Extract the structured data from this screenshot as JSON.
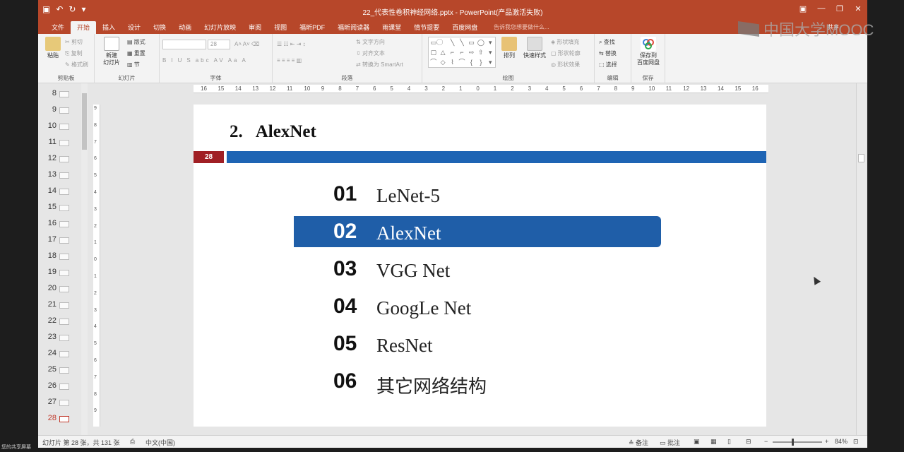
{
  "window": {
    "title": "22_代表性卷积神经网络.pptx - PowerPoint(产品激活失败)",
    "qat_icons": [
      "save-icon",
      "undo-icon",
      "redo-icon",
      "customize-icon"
    ],
    "controls": [
      "▣",
      "—",
      "❐",
      "✕"
    ]
  },
  "tabs": [
    "文件",
    "开始",
    "插入",
    "设计",
    "切换",
    "动画",
    "幻灯片放映",
    "审阅",
    "视图",
    "福昕PDF",
    "福昕阅读器",
    "雨课堂",
    "情节提要",
    "百度网盘"
  ],
  "active_tab": "开始",
  "tell_me": "告诉我您想要做什么...",
  "share": "共享",
  "ribbon": {
    "clipboard": {
      "label": "剪贴板",
      "paste": "粘贴",
      "cut": "剪切",
      "copy": "复制",
      "format_painter": "格式刷"
    },
    "slides": {
      "label": "幻灯片",
      "new_slide": "新建\n幻灯片",
      "layout": "版式",
      "reset": "重置",
      "section": "节"
    },
    "font": {
      "label": "字体",
      "font_size": "28",
      "styles": [
        "B",
        "I",
        "U",
        "S",
        "abc",
        "AV",
        "Aa",
        "A"
      ]
    },
    "paragraph": {
      "label": "段落",
      "text_direction": "文字方向",
      "align_text": "对齐文本",
      "smartart": "转换为 SmartArt"
    },
    "drawing": {
      "label": "绘图",
      "arrange": "排列",
      "quick_styles": "快速样式",
      "shape_fill": "形状填充",
      "shape_outline": "形状轮廓",
      "shape_effects": "形状效果"
    },
    "editing": {
      "label": "编辑",
      "find": "查找",
      "replace": "替换",
      "select": "选择"
    },
    "save": {
      "label": "保存",
      "save_to_baidu": "保存到\n百度网盘"
    }
  },
  "thumbnails": [
    "8",
    "9",
    "10",
    "11",
    "12",
    "13",
    "14",
    "15",
    "16",
    "17",
    "18",
    "19",
    "20",
    "21",
    "22",
    "23",
    "24",
    "25",
    "26",
    "27",
    "28"
  ],
  "active_slide": "28",
  "ruler_h": [
    "16",
    "15",
    "14",
    "13",
    "12",
    "11",
    "10",
    "9",
    "8",
    "7",
    "6",
    "5",
    "4",
    "3",
    "2",
    "1",
    "0",
    "1",
    "2",
    "3",
    "4",
    "5",
    "6",
    "7",
    "8",
    "9",
    "10",
    "11",
    "12",
    "13",
    "14",
    "15",
    "16"
  ],
  "ruler_v": [
    "9",
    "8",
    "7",
    "6",
    "5",
    "4",
    "3",
    "2",
    "1",
    "0",
    "1",
    "2",
    "3",
    "4",
    "5",
    "6",
    "7",
    "8",
    "9"
  ],
  "slide": {
    "title_num": "2.",
    "title": "AlexNet",
    "page_no": "28",
    "agenda": [
      {
        "num": "01",
        "text": "LeNet-5",
        "active": false
      },
      {
        "num": "02",
        "text": "AlexNet",
        "active": true
      },
      {
        "num": "03",
        "text": "VGG Net",
        "active": false
      },
      {
        "num": "04",
        "text": "GoogLe Net",
        "active": false
      },
      {
        "num": "05",
        "text": "ResNet",
        "active": false
      },
      {
        "num": "06",
        "text": "其它网络结构",
        "active": false
      }
    ],
    "colors": {
      "accent_bar": "#1e64b4",
      "badge": "#a01f24",
      "active_item": "#1f5ea8"
    }
  },
  "status": {
    "slide_info": "幻灯片 第 28 张，共 131 张",
    "language": "中文(中国)",
    "notes": "备注",
    "comments": "批注",
    "zoom": "84%",
    "zoom_level": 0.84
  },
  "watermark": "中国大学MOOC",
  "share_screen": "您的共享屏幕"
}
